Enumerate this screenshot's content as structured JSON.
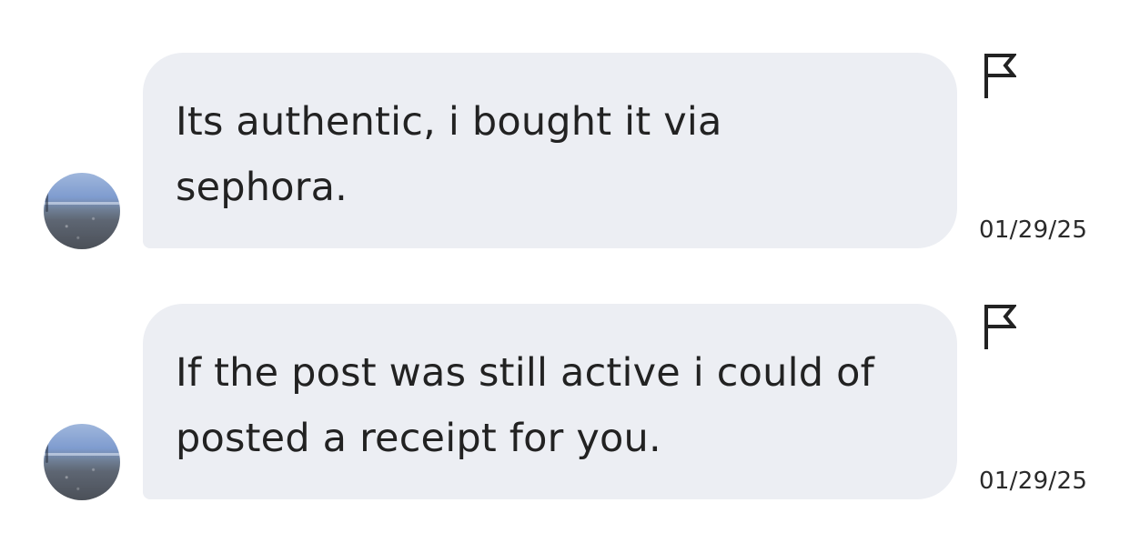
{
  "messages": [
    {
      "text": "Its authentic, i bought it via sephora.",
      "timestamp": "01/29/25",
      "flag_icon": "flag-icon",
      "avatar": "avatar-photo"
    },
    {
      "text": "If the post was still active i could of posted a receipt for you.",
      "timestamp": "01/29/25",
      "flag_icon": "flag-icon",
      "avatar": "avatar-photo"
    }
  ],
  "colors": {
    "background": "#ffffff",
    "bubble": "#eceef3",
    "text": "#222222"
  }
}
